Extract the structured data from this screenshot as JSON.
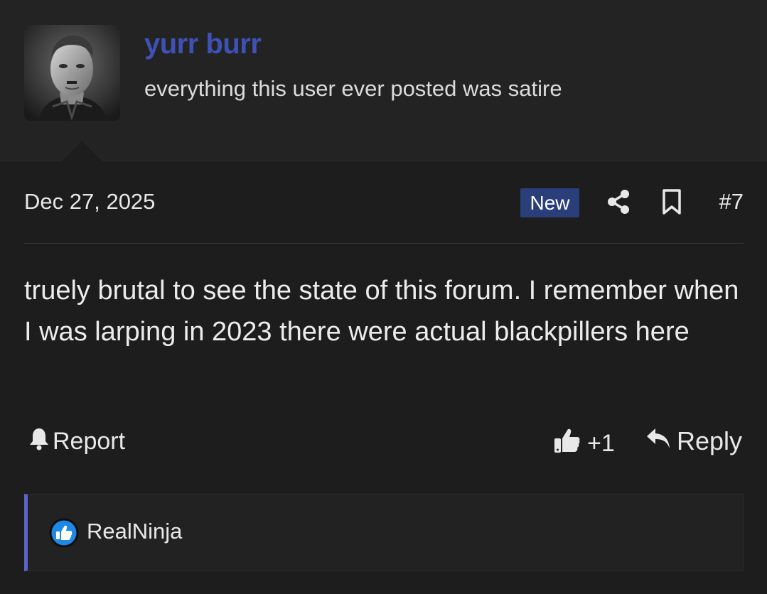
{
  "user": {
    "name": "yurr burr",
    "title": "everything this user ever posted was satire",
    "name_color": "#3f51b5"
  },
  "post": {
    "date": "Dec 27, 2025",
    "badge": "New",
    "number": "#7",
    "body": "truely brutal to see the state of this forum. I remember when I was larping in 2023 there were actual blackpillers here"
  },
  "actions": {
    "report_label": "Report",
    "like_count": "+1",
    "reply_label": "Reply"
  },
  "reactions": {
    "users": "RealNinja",
    "icon": "thumbs-up-icon"
  },
  "icons": {
    "share": "share-icon",
    "bookmark": "bookmark-icon",
    "report": "bell-icon",
    "like": "thumbs-up-icon",
    "reply": "reply-arrow-icon"
  },
  "colors": {
    "background": "#1d1d1d",
    "badge": "#2a3e7a",
    "accent": "#5b64c8"
  }
}
